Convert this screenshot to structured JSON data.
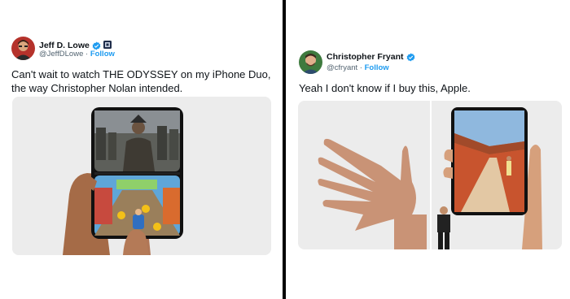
{
  "tweets": [
    {
      "author_name": "Jeff D. Lowe",
      "handle": "@JeffDLowe",
      "separator": "·",
      "follow_label": "Follow",
      "text": "Can't wait to watch THE ODYSSEY on my iPhone Duo, the way Christopher Nolan intended.",
      "icons": [
        "verified-badge-icon",
        "flag-badge-icon"
      ]
    },
    {
      "author_name": "Christopher Fryant",
      "handle": "@cfryant",
      "separator": "·",
      "follow_label": "Follow",
      "text": "Yeah I don't know if I buy this, Apple.",
      "icons": [
        "verified-badge-icon"
      ]
    }
  ],
  "colors": {
    "verified": "#1d9bf0",
    "follow": "#1d9bf0",
    "text": "#0f1419",
    "secondary_text": "#536471",
    "divider": "#000000",
    "media_bg": "#ececec"
  }
}
